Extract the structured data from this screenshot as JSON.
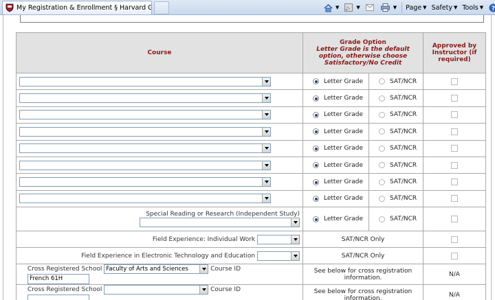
{
  "browser": {
    "tab_title": "My Registration & Enrollment § Harvard Graduat...",
    "commands": [
      {
        "label": "",
        "icon": "home-icon"
      },
      {
        "label": "",
        "icon": "feeds-icon"
      },
      {
        "label": "",
        "icon": "mail-icon"
      },
      {
        "label": "",
        "icon": "print-icon"
      },
      {
        "label": "Page",
        "icon": ""
      },
      {
        "label": "Safety",
        "icon": ""
      },
      {
        "label": "Tools",
        "icon": ""
      },
      {
        "label": "",
        "icon": "help-icon"
      }
    ]
  },
  "table": {
    "header": {
      "course": "Course",
      "grade_option_title": "Grade Option",
      "grade_option_note": "Letter Grade is the default option, otherwise choose Satisfactory/No Credit",
      "approved": "Approved by Instructor (if required)"
    },
    "letter_grade": "Letter Grade",
    "sat_ncr": "SAT/NCR",
    "course_rows": [
      {
        "course": "",
        "grade": "letter"
      },
      {
        "course": "",
        "grade": "letter"
      },
      {
        "course": "",
        "grade": "letter"
      },
      {
        "course": "",
        "grade": "letter"
      },
      {
        "course": "",
        "grade": "letter"
      },
      {
        "course": "",
        "grade": "letter"
      },
      {
        "course": "",
        "grade": "letter"
      },
      {
        "course": "",
        "grade": "letter"
      }
    ],
    "special_reading_label": "Special Reading or Research (Independent Study)",
    "field_experience_label": "Field Experience: Individual Work",
    "field_experience_grade": "SAT/NCR Only",
    "field_experience_tech_label": "Field Experience in Electronic Technology and Education",
    "field_experience_tech_grade": "SAT/NCR Only",
    "cross_registered": [
      {
        "label": "Cross Registered School",
        "school": "Faculty of Arts and Sciences",
        "course_id_label": "Course ID",
        "course_id": "French 61H",
        "note": "See below for cross registration information.",
        "approved": "N/A"
      },
      {
        "label": "Cross Registered School",
        "school": "",
        "course_id_label": "Course ID",
        "course_id": "",
        "note": "See below for cross registration information.",
        "approved": "N/A"
      }
    ]
  },
  "colors": {
    "header_text": "#8b1a1a",
    "header_bg": "#e2e2e2",
    "toolbar_bg": "#d3e0f1"
  }
}
